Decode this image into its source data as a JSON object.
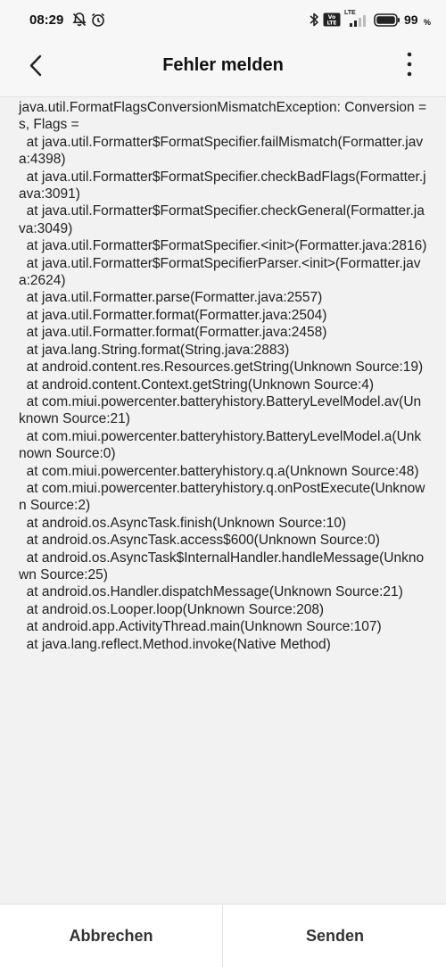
{
  "status_bar": {
    "time": "08:29",
    "battery_percent": "99",
    "percent_sign": "%",
    "network_label": "LTE",
    "icons": [
      "notifications-off-icon",
      "alarm-icon",
      "bluetooth-icon",
      "volte-icon",
      "signal-icon",
      "battery-icon"
    ]
  },
  "header": {
    "title": "Fehler melden",
    "back_icon": "chevron-left-icon",
    "menu_icon": "more-vertical-icon"
  },
  "log": {
    "text": "java.util.FormatFlagsConversionMismatchException: Conversion = s, Flags = \n  at java.util.Formatter$FormatSpecifier.failMismatch(Formatter.java:4398)\n  at java.util.Formatter$FormatSpecifier.checkBadFlags(Formatter.java:3091)\n  at java.util.Formatter$FormatSpecifier.checkGeneral(Formatter.java:3049)\n  at java.util.Formatter$FormatSpecifier.<init>(Formatter.java:2816)\n  at java.util.Formatter$FormatSpecifierParser.<init>(Formatter.java:2624)\n  at java.util.Formatter.parse(Formatter.java:2557)\n  at java.util.Formatter.format(Formatter.java:2504)\n  at java.util.Formatter.format(Formatter.java:2458)\n  at java.lang.String.format(String.java:2883)\n  at android.content.res.Resources.getString(Unknown Source:19)\n  at android.content.Context.getString(Unknown Source:4)\n  at com.miui.powercenter.batteryhistory.BatteryLevelModel.av(Unknown Source:21)\n  at com.miui.powercenter.batteryhistory.BatteryLevelModel.a(Unknown Source:0)\n  at com.miui.powercenter.batteryhistory.q.a(Unknown Source:48)\n  at com.miui.powercenter.batteryhistory.q.onPostExecute(Unknown Source:2)\n  at android.os.AsyncTask.finish(Unknown Source:10)\n  at android.os.AsyncTask.access$600(Unknown Source:0)\n  at android.os.AsyncTask$InternalHandler.handleMessage(Unknown Source:25)\n  at android.os.Handler.dispatchMessage(Unknown Source:21)\n  at android.os.Looper.loop(Unknown Source:208)\n  at android.app.ActivityThread.main(Unknown Source:107)\n  at java.lang.reflect.Method.invoke(Native Method)"
  },
  "actions": {
    "cancel_label": "Abbrechen",
    "send_label": "Senden"
  }
}
